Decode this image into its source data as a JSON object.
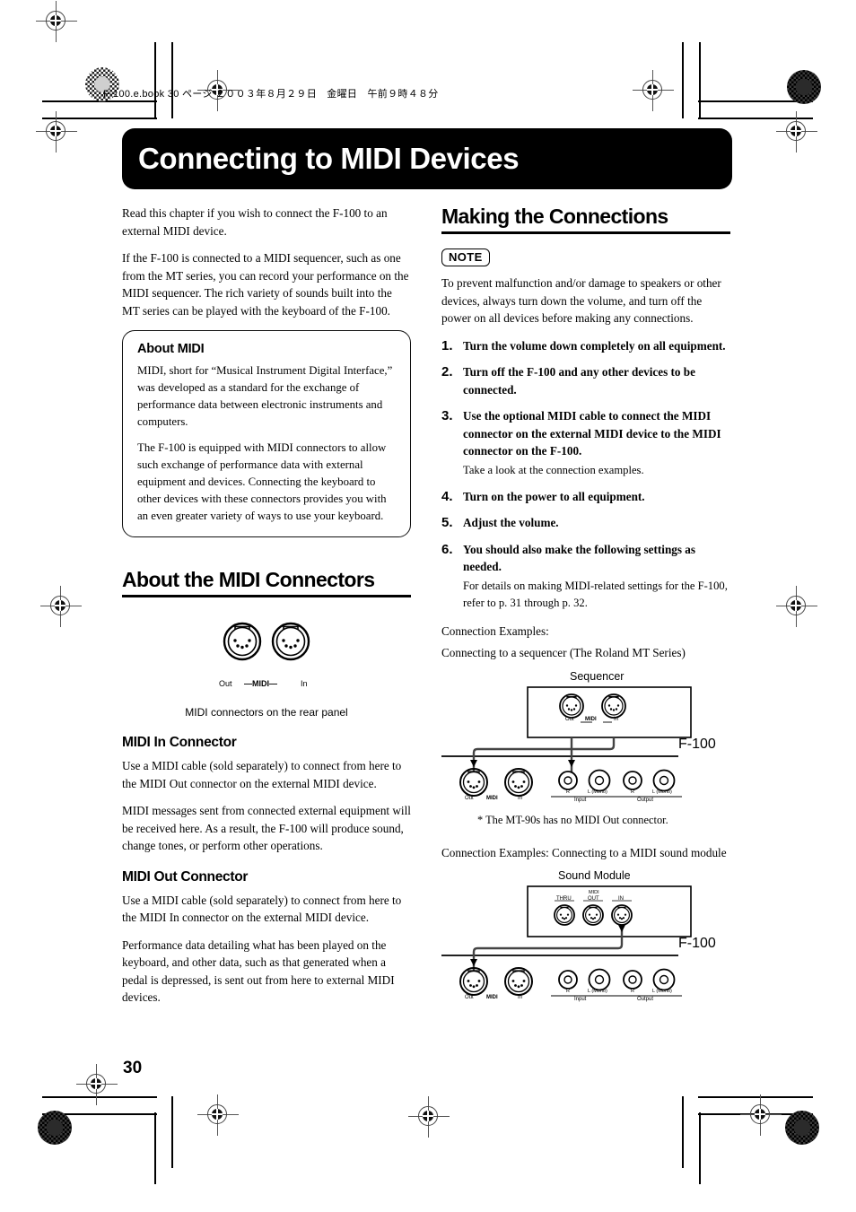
{
  "page": {
    "book_header": "F-100.e.book  30 ページ  ２００３年８月２９日　金曜日　午前９時４８分",
    "number": "30"
  },
  "chapter": {
    "title": "Connecting to MIDI Devices"
  },
  "left_column": {
    "intro_paragraphs": [
      "Read this chapter if you wish to connect the F-100 to an external MIDI device.",
      "If the F-100 is connected to a MIDI sequencer, such as one from the MT series, you can record your performance on the MIDI sequencer. The rich variety of sounds built into the MT series can be played with the keyboard of the F-100."
    ],
    "about_midi_box": {
      "heading": "About MIDI",
      "paragraphs": [
        "MIDI, short for “Musical Instrument Digital Interface,” was developed as a standard for the exchange of performance data between electronic instruments and computers.",
        "The F-100 is equipped with MIDI connectors to allow such exchange of performance data with external equipment and devices. Connecting the keyboard to other devices with these connectors provides you with an even greater variety of ways to use your keyboard."
      ]
    },
    "connectors_section": {
      "heading": "About the MIDI Connectors",
      "diagram": {
        "left_label": "Out",
        "center_label": "—MIDI—",
        "right_label": "In",
        "caption": "MIDI connectors on the rear panel"
      }
    },
    "midi_in": {
      "heading": "MIDI In Connector",
      "paragraphs": [
        "Use a MIDI cable (sold separately) to connect from here to the MIDI Out connector on the external MIDI device.",
        "MIDI messages sent from connected external equipment will be received here. As a result, the F-100 will produce sound, change tones, or perform other operations."
      ]
    },
    "midi_out": {
      "heading": "MIDI Out Connector",
      "paragraphs": [
        "Use a MIDI cable (sold separately) to connect from here to the MIDI In connector on the external MIDI device.",
        "Performance data detailing what has been played on the keyboard, and other data, such as that generated when a pedal is depressed, is sent out from here to external MIDI devices."
      ]
    }
  },
  "right_column": {
    "heading": "Making the Connections",
    "note": {
      "badge": "NOTE",
      "text": "To prevent malfunction and/or damage to speakers or other devices, always turn down the volume, and turn off the power on all devices before making any connections."
    },
    "steps": [
      {
        "num": "1.",
        "text": "Turn the volume down completely on all equipment.",
        "sub": ""
      },
      {
        "num": "2.",
        "text": "Turn off the F-100 and any other devices to be connected.",
        "sub": ""
      },
      {
        "num": "3.",
        "text": "Use the optional MIDI cable to connect the MIDI connector on the external MIDI device to the MIDI connector on the F-100.",
        "sub": "Take a look at the connection examples."
      },
      {
        "num": "4.",
        "text": "Turn on the power to all equipment.",
        "sub": ""
      },
      {
        "num": "5.",
        "text": "Adjust the volume.",
        "sub": ""
      },
      {
        "num": "6.",
        "text": "You should also make the following settings as needed.",
        "sub": "For details on making MIDI-related settings for the F-100, refer to p. 31 through p. 32."
      }
    ],
    "example1": {
      "intro_line1": "Connection Examples:",
      "intro_line2": "Connecting to a sequencer (The Roland MT Series)",
      "device_label": "Sequencer",
      "device_out": "Out",
      "device_midi": "MIDI",
      "device_in": "In",
      "f100_label": "F-100",
      "f100_out": "Out",
      "f100_midi": "MIDI",
      "f100_in": "In",
      "input_group": "Input",
      "input_r": "R",
      "input_l": "L (Mono)",
      "output_group": "Output",
      "output_r": "R",
      "output_l": "L (Mono)",
      "footnote": "* The MT-90s has no MIDI Out connector."
    },
    "example2": {
      "intro": "Connection Examples: Connecting to a MIDI sound module",
      "device_label": "Sound Module",
      "device_midi": "MIDI",
      "device_thru": "THRU",
      "device_out": "OUT",
      "device_in": "IN",
      "f100_label": "F-100",
      "f100_out": "Out",
      "f100_midi": "MIDI",
      "f100_in": "In",
      "input_group": "Input",
      "input_r": "R",
      "input_l": "L (Mono)",
      "output_group": "Output",
      "output_r": "R",
      "output_l": "L (Mono)"
    }
  }
}
